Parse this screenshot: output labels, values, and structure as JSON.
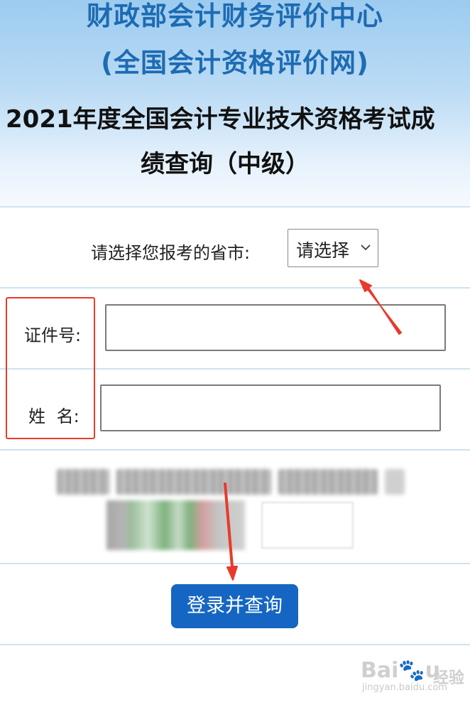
{
  "header": {
    "org_line1": "财政部会计财务评价中心",
    "org_line2": "(全国会计资格评价网)",
    "title_line1": "2021年度全国会计专业技术资格考试成",
    "title_line2": "绩查询（中级）"
  },
  "form": {
    "province_label": "请选择您报考的省市:",
    "province_select_value": "请选择",
    "id_label": "证件号:",
    "name_label": "姓 名:",
    "submit_label": "登录并查询"
  },
  "watermark": {
    "logo": "Bai 经验",
    "jingyan": "经验",
    "url": "jingyan.baidu.com"
  },
  "colors": {
    "brand_blue": "#1d6bb3",
    "button_blue": "#1466c2",
    "annotation_red": "#e83a2c"
  }
}
